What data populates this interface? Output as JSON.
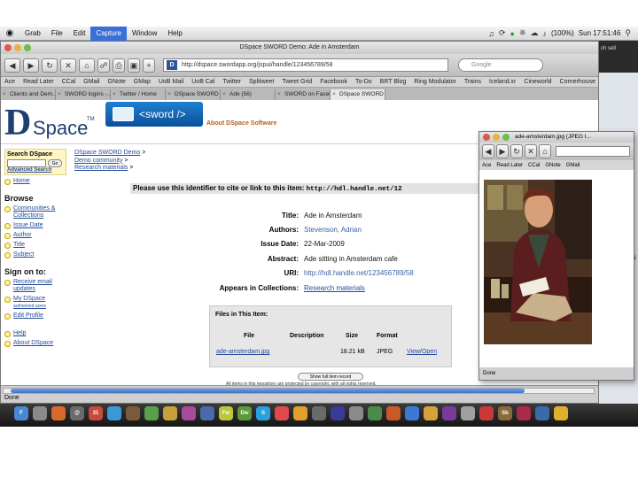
{
  "menubar": {
    "items": [
      "Grab",
      "File",
      "Edit",
      "Capture",
      "Window",
      "Help"
    ],
    "active_index": 3,
    "battery": "(100%)",
    "clock": "Sun 17:51:46"
  },
  "browser": {
    "window_title": "DSpace SWORD Demo: Ade in Amsterdam",
    "url": "http://dspace.swordapp.org/jspui/handle/123456789/58",
    "search_placeholder": "Google",
    "bookmarks": [
      "Ace",
      "Read Later",
      "CCal",
      "GMail",
      "GNote",
      "GMap",
      "UoB Mail",
      "UoB Cal",
      "Twitter",
      "Splitweet",
      "Tweet Grid",
      "Facebook",
      "To-Do",
      "BRT Blog",
      "Ring Modulator",
      "Trains",
      "Iceland.xr",
      "Cineworld",
      "Cornerhouse"
    ],
    "tabs": [
      "Clients and Dem...",
      "SWORD logins -...",
      "Twitter / Home",
      "DSpace SWORD ...",
      "Ade (56)",
      "SWORD on Faceb...",
      "DSpace SWORD ..."
    ],
    "status": "Done"
  },
  "header": {
    "logo_d": "D",
    "logo_space": "Space",
    "logo_tm": "TM",
    "sword_label": "<sword />",
    "about_link": "About DSpace Software"
  },
  "sidebar": {
    "search_title": "Search DSpace",
    "go_label": "Go",
    "advanced_search": "Advanced Search",
    "home": "Home",
    "browse_title": "Browse",
    "browse_items": [
      "Communities & Collections",
      "Issue Date",
      "Author",
      "Title",
      "Subject"
    ],
    "signon_title": "Sign on to:",
    "signon_items": [
      "Receive email updates",
      "My DSpace",
      "Edit Profile"
    ],
    "help": "Help",
    "about": "About DSpace",
    "my_dspace_sub": "authorized users"
  },
  "breadcrumb": {
    "items": [
      "DSpace SWORD Demo",
      "Demo community",
      "Research materials"
    ],
    "separator": ">"
  },
  "item": {
    "cite_text": "Please use this identifier to cite or link to this item:",
    "cite_handle": "http://hdl.handle.net/12",
    "meta": [
      {
        "label": "Title:",
        "value": "Ade in Amsterdam"
      },
      {
        "label": "Authors:",
        "value": "Stevenson, Adrian"
      },
      {
        "label": "Issue Date:",
        "value": "22-Mar-2009"
      },
      {
        "label": "Abstract:",
        "value": "Ade sitting in Amsterdam cafe"
      },
      {
        "label": "URI:",
        "value": "http://hdl.handle.net/123456789/58"
      },
      {
        "label": "Appears in Collections:",
        "value": "Research materials"
      }
    ]
  },
  "files": {
    "title": "Files in This Item:",
    "headers": [
      "File",
      "Description",
      "Size",
      "Format"
    ],
    "row": {
      "file": "ade-amsterdam.jpg",
      "description": "",
      "size": "18.21 kB",
      "format": "JPEG",
      "action": "View/Open"
    },
    "show_full": "Show full item record",
    "footer_note": "All items in this repository are protected by copyright, with all rights reserved."
  },
  "popup": {
    "title": "ade-amsterdam.jpg (JPEG I...",
    "bookmarks": [
      "Ace",
      "Read Later",
      "CCal",
      "GNote",
      "GMail"
    ],
    "status": "Done"
  },
  "desktop": {
    "label_1": "ls",
    "label_2": "e",
    "top_label": "ch sell"
  },
  "dock": {
    "icons": [
      {
        "label": "F",
        "color": "#4a88d6"
      },
      {
        "label": "",
        "color": "#8a8a8a"
      },
      {
        "label": "",
        "color": "#d66a2a"
      },
      {
        "label": "@",
        "color": "#6b6b6b"
      },
      {
        "label": "31",
        "color": "#c84a3a"
      },
      {
        "label": "",
        "color": "#3a9ad6"
      },
      {
        "label": "",
        "color": "#7a5a3a"
      },
      {
        "label": "",
        "color": "#5aa04a"
      },
      {
        "label": "",
        "color": "#c8a03a"
      },
      {
        "label": "",
        "color": "#aa4a9a"
      },
      {
        "label": "",
        "color": "#4a6aaa"
      },
      {
        "label": "Fw",
        "color": "#b8c83a"
      },
      {
        "label": "Dw",
        "color": "#5a9a3a"
      },
      {
        "label": "S",
        "color": "#2aa0e0"
      },
      {
        "label": "",
        "color": "#e04a4a"
      },
      {
        "label": "",
        "color": "#e0a02a"
      },
      {
        "label": "",
        "color": "#6a6a6a"
      },
      {
        "label": "",
        "color": "#3a3a9a"
      },
      {
        "label": "",
        "color": "#8a8a8a"
      },
      {
        "label": "",
        "color": "#4a8a4a"
      },
      {
        "label": "",
        "color": "#c85a2a"
      },
      {
        "label": "",
        "color": "#3a7ad6"
      },
      {
        "label": "",
        "color": "#d6a03a"
      },
      {
        "label": "",
        "color": "#7a3a9a"
      },
      {
        "label": "",
        "color": "#a0a0a0"
      },
      {
        "label": "",
        "color": "#c83a3a"
      },
      {
        "label": "Sb",
        "color": "#8a6a3a"
      },
      {
        "label": "",
        "color": "#aa2a4a"
      },
      {
        "label": "",
        "color": "#3a6aaa"
      },
      {
        "label": "",
        "color": "#e0b02a"
      }
    ]
  }
}
